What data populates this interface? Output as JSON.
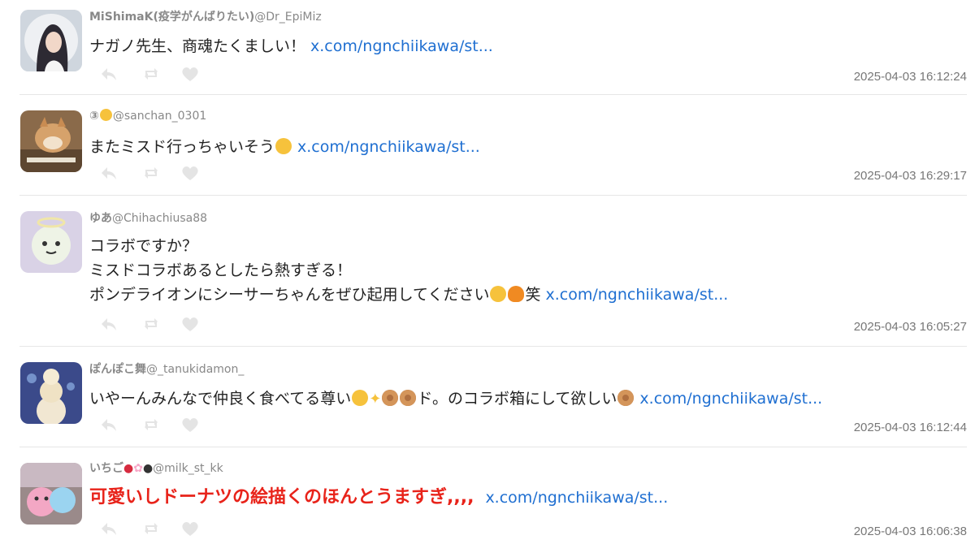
{
  "tweets": [
    {
      "display_name": "MiShimaK(疫学がんばりたい)",
      "handle": "@Dr_EpiMiz",
      "text": "ナガノ先生、商魂たくましい！",
      "link": "x.com/ngnchiikawa/st...",
      "timestamp": "2025-04-03 16:12:24"
    },
    {
      "display_name": "③",
      "handle": "@sanchan_0301",
      "text": "またミスド行っちゃいそう",
      "link": "x.com/ngnchiikawa/st...",
      "timestamp": "2025-04-03 16:29:17"
    },
    {
      "display_name": "ゆあ",
      "handle": "@Chihachiusa88",
      "text_lines": [
        "コラボですか？",
        "ミスドコラボあるとしたら熱すぎる！",
        "ポンデライオンにシーサーちゃんをぜひ起用してください"
      ],
      "text_suffix": "笑",
      "link": "x.com/ngnchiikawa/st...",
      "timestamp": "2025-04-03 16:05:27"
    },
    {
      "display_name": "ぽんぽこ舞",
      "handle": "@_tanukidamon_",
      "text_a": "いやーんみんなで仲良く食べてる尊い",
      "text_b": "ド。のコラボ箱にして欲しい",
      "link": "x.com/ngnchiikawa/st...",
      "timestamp": "2025-04-03 16:12:44"
    },
    {
      "display_name": "いちご",
      "handle": "@milk_st_kk",
      "text": "可愛いしドーナツの絵描くのほんとうますぎ,,,,",
      "link": "x.com/ngnchiikawa/st...",
      "timestamp": "2025-04-03 16:06:38"
    }
  ],
  "colors": {
    "link": "#1f6fd1",
    "highlight_text": "#e8231a",
    "meta": "#888888"
  },
  "icons": [
    "reply-icon",
    "retweet-icon",
    "like-icon"
  ]
}
